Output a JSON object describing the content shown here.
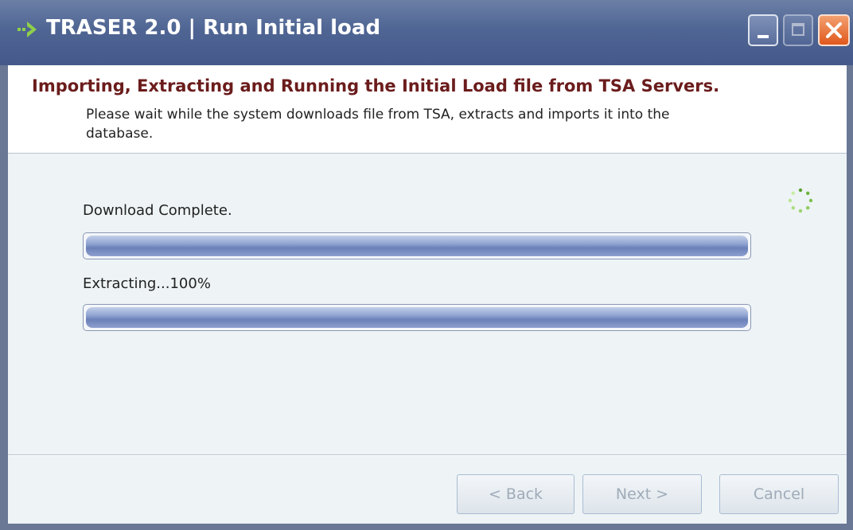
{
  "window": {
    "title": "TRASER 2.0 | Run Initial load",
    "icons": [
      "arrow-right-icon",
      "minimize-icon",
      "maximize-icon",
      "close-icon"
    ]
  },
  "header": {
    "title": "Importing, Extracting and Running the Initial Load file from TSA Servers.",
    "subtitle": "Please wait while the system downloads file from TSA, extracts and imports it into the database."
  },
  "progress": {
    "download_label": "Download Complete.",
    "download_fraction": 1.0,
    "extract_label": "Extracting...100%",
    "extract_fraction": 1.0
  },
  "buttons": {
    "back": "< Back",
    "next": "Next >",
    "cancel": "Cancel"
  },
  "colors": {
    "titlebar": "#4f6593",
    "header_title": "#6b1c1c",
    "progress_fill": "#7d92c4",
    "spinner": "#5aa02c",
    "close_button": "#e0581c"
  }
}
